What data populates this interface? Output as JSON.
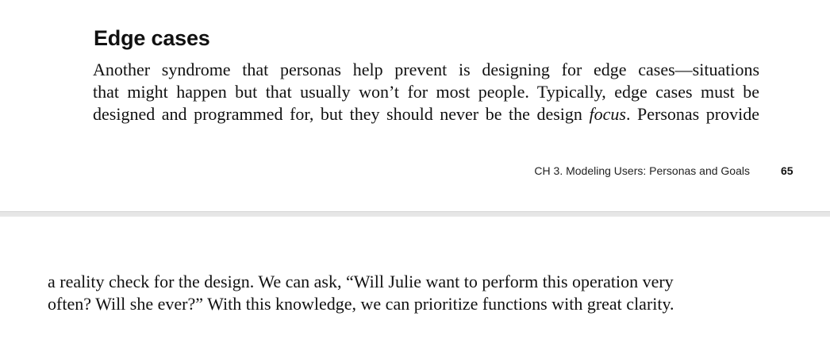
{
  "page_top": {
    "heading": "Edge cases",
    "lines": [
      "Another syndrome that personas help prevent is designing for edge cases—situations",
      "that might happen but that usually won’t for most people. Typically, edge cases must be"
    ],
    "line3_before": "designed and programmed for, but they should never be the design ",
    "line3_italic": "focus",
    "line3_after": ". Personas provide",
    "running_footer": "CH 3. Modeling Users: Personas and Goals",
    "page_number": "65"
  },
  "page_bottom": {
    "lines": [
      "a reality check for the design. We can ask, “Will Julie want to perform this operation very",
      "often? Will she ever?” With this knowledge, we can prioritize functions with great clarity."
    ]
  }
}
